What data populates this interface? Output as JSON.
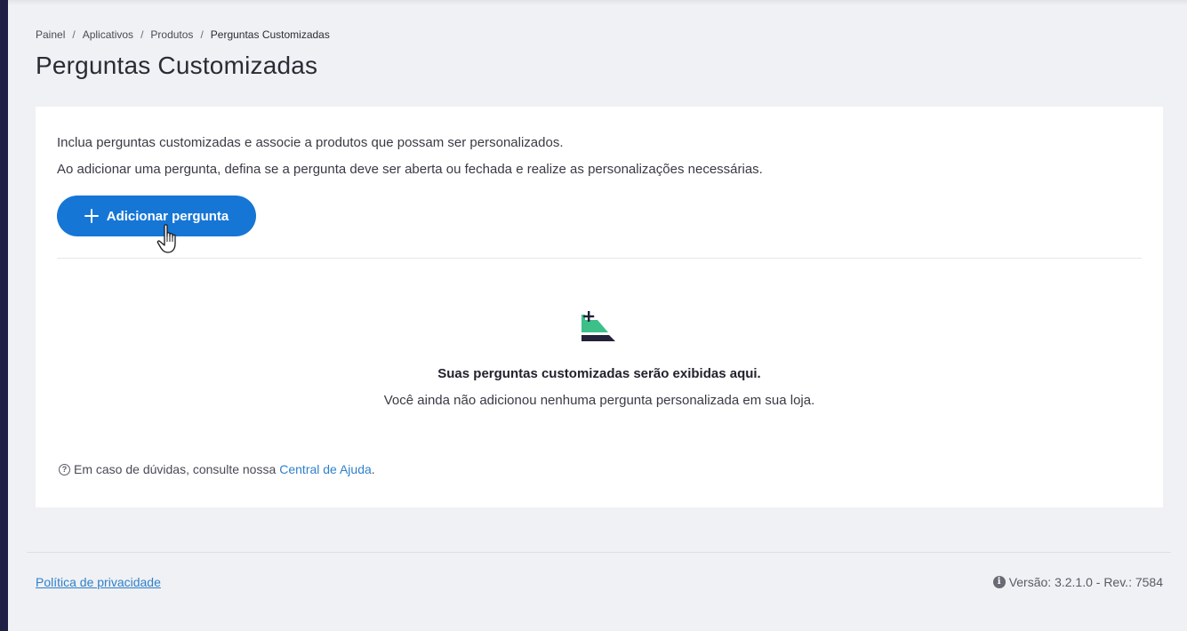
{
  "breadcrumb": {
    "items": [
      "Painel",
      "Aplicativos",
      "Produtos"
    ],
    "current": "Perguntas Customizadas",
    "separator": "/"
  },
  "page": {
    "title": "Perguntas Customizadas"
  },
  "card": {
    "intro_line_1": "Inclua perguntas customizadas e associe a produtos que possam ser personalizados.",
    "intro_line_2": "Ao adicionar uma pergunta, defina se a pergunta deve ser aberta ou fechada e realize as personalizações necessárias.",
    "add_button_label": "Adicionar pergunta",
    "empty_state": {
      "title": "Suas perguntas customizadas serão exibidas aqui.",
      "subtitle": "Você ainda não adicionou nenhuma pergunta personalizada em sua loja."
    },
    "help": {
      "icon": "?",
      "text": "Em caso de dúvidas, consulte nossa",
      "link_label": "Central de Ajuda",
      "suffix": "."
    }
  },
  "footer": {
    "privacy_link": "Política de privacidade",
    "info_icon": "i",
    "version": "Versão: 3.2.1.0 - Rev.: 7584"
  },
  "colors": {
    "primary": "#1676d6",
    "link": "#2f80c9",
    "sidebar": "#1f1f45",
    "background": "#f0f1f4",
    "empty_icon_green": "#3dbf8a"
  }
}
